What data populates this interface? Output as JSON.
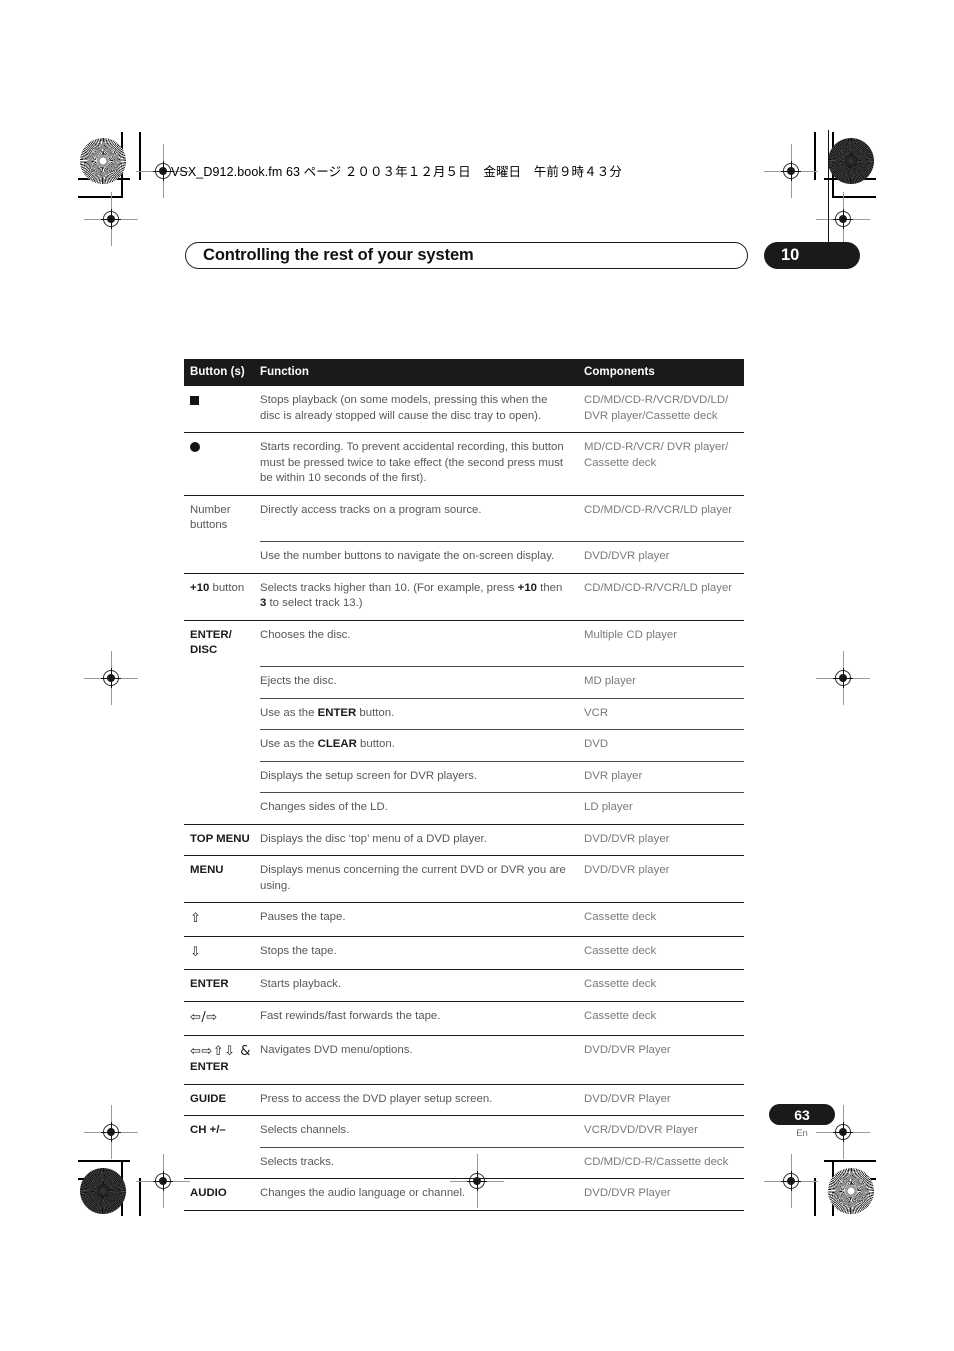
{
  "print_marks": {
    "filename_header": "VSX_D912.book.fm 63 ページ ２００３年１２月５日　金曜日　午前９時４３分"
  },
  "header": {
    "title": "Controlling the rest of your system",
    "chapter": "10"
  },
  "table": {
    "columns": [
      "Button (s)",
      "Function",
      "Components"
    ],
    "rows": [
      {
        "button_icon": "stop-square-icon",
        "button": "",
        "function": "Stops playback (on some models, pressing this when the disc is already stopped will cause the disc tray to open).",
        "components": "CD/MD/CD-R/VCR/DVD/LD/ DVR player/Cassette deck",
        "separator": "none"
      },
      {
        "button_icon": "record-circle-icon",
        "button": "",
        "function": "Starts recording. To prevent accidental recording, this button must be pressed twice to take effect (the second press must be within 10 seconds of the first).",
        "components": "MD/CD-R/VCR/ DVR player/ Cassette deck",
        "separator": "group"
      },
      {
        "button": "Number buttons",
        "button_style": "plain",
        "function": "Directly access tracks on a program source.",
        "components": "CD/MD/CD-R/VCR/LD player",
        "separator": "group"
      },
      {
        "button": "",
        "function": "Use the number buttons to navigate the on-screen display.",
        "components": "DVD/DVR player",
        "separator": "sub"
      },
      {
        "button_rich": [
          {
            "t": "+10",
            "b": true
          },
          {
            "t": " button",
            "b": false
          }
        ],
        "function_rich": [
          {
            "t": "Selects tracks higher than 10. (For example, press ",
            "b": false
          },
          {
            "t": "+10",
            "b": true
          },
          {
            "t": " then ",
            "b": false
          },
          {
            "t": "3",
            "b": true
          },
          {
            "t": " to select track 13.)",
            "b": false
          }
        ],
        "components": "CD/MD/CD-R/VCR/LD player",
        "separator": "group"
      },
      {
        "button": "ENTER/ DISC",
        "function": "Chooses the disc.",
        "components": "Multiple CD player",
        "separator": "group"
      },
      {
        "button": "",
        "function": "Ejects the disc.",
        "components": "MD player",
        "separator": "sub"
      },
      {
        "button": "",
        "function_rich": [
          {
            "t": "Use as the ",
            "b": false
          },
          {
            "t": "ENTER",
            "b": true
          },
          {
            "t": " button.",
            "b": false
          }
        ],
        "components": "VCR",
        "separator": "sub"
      },
      {
        "button": "",
        "function_rich": [
          {
            "t": "Use as the ",
            "b": false
          },
          {
            "t": "CLEAR",
            "b": true
          },
          {
            "t": " button.",
            "b": false
          }
        ],
        "components": "DVD",
        "separator": "sub"
      },
      {
        "button": "",
        "function": "Displays the setup screen for DVR players.",
        "components": "DVR player",
        "separator": "sub"
      },
      {
        "button": "",
        "function": "Changes sides of the LD.",
        "components": "LD player",
        "separator": "sub"
      },
      {
        "button": "TOP MENU",
        "function": "Displays the disc ‘top’ menu of a DVD player.",
        "components": "DVD/DVR player",
        "separator": "group"
      },
      {
        "button": "MENU",
        "function": "Displays menus concerning the current DVD or DVR you are using.",
        "components": "DVD/DVR player",
        "separator": "group"
      },
      {
        "button_glyph": "⇧",
        "button_icon": "arrow-up-icon",
        "button": "",
        "function": "Pauses the tape.",
        "components": "Cassette deck",
        "separator": "group"
      },
      {
        "button_glyph": "⇩",
        "button_icon": "arrow-down-icon",
        "button": "",
        "function": "Stops the tape.",
        "components": "Cassette deck",
        "separator": "group"
      },
      {
        "button": "ENTER",
        "function": "Starts playback.",
        "components": "Cassette deck",
        "separator": "group"
      },
      {
        "button_glyph": "⇦/⇨",
        "button_icon": "arrow-left-right-icon",
        "button": "",
        "function": "Fast rewinds/fast forwards the tape.",
        "components": "Cassette deck",
        "separator": "group"
      },
      {
        "button_glyph": "⇦⇨⇧⇩ &",
        "button_icon": "arrow-cluster-icon",
        "button": "ENTER",
        "function": "Navigates DVD menu/options.",
        "components": "DVD/DVR Player",
        "separator": "group"
      },
      {
        "button": "GUIDE",
        "function": "Press to access the DVD player setup screen.",
        "components": "DVD/DVR Player",
        "separator": "group"
      },
      {
        "button": "CH +/–",
        "function": "Selects channels.",
        "components": "VCR/DVD/DVR Player",
        "separator": "group"
      },
      {
        "button": "",
        "function": "Selects tracks.",
        "components": "CD/MD/CD-R/Cassette deck",
        "separator": "sub"
      },
      {
        "button": "AUDIO",
        "function": "Changes the audio language or channel.",
        "components": "DVD/DVR Player",
        "separator": "group"
      }
    ]
  },
  "footer": {
    "page_number": "63",
    "language": "En"
  }
}
